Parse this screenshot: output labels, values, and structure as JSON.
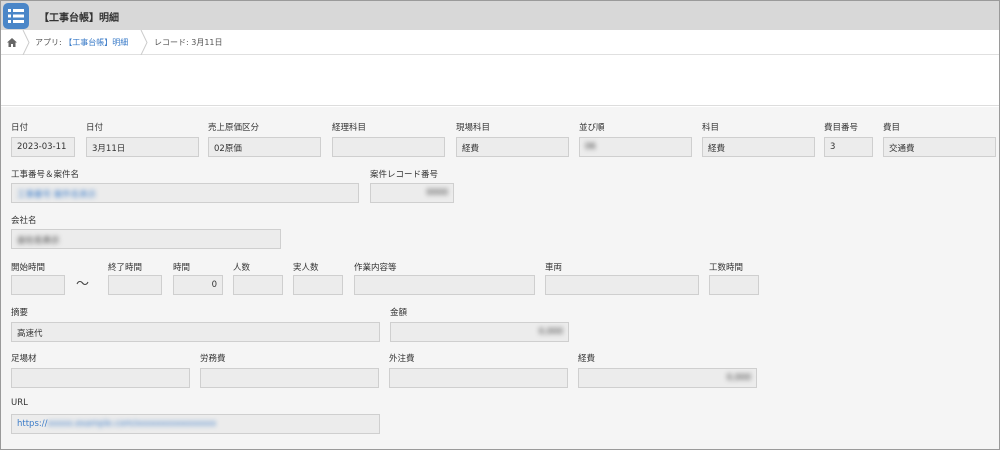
{
  "header": {
    "title": "【工事台帳】明細"
  },
  "breadcrumb": {
    "app_prefix": "アプリ: ",
    "app_name": "【工事台帳】明細",
    "record": "レコード: 3月11日"
  },
  "fields": {
    "date1": {
      "label": "日付",
      "value": "2023-03-11"
    },
    "date2": {
      "label": "日付",
      "value": "3月11日"
    },
    "sales_cost": {
      "label": "売上原価区分",
      "value": "02原価"
    },
    "account_item": {
      "label": "経理科目",
      "value": ""
    },
    "site_item": {
      "label": "現場科目",
      "value": "経費"
    },
    "order": {
      "label": "並び順",
      "value": "06"
    },
    "subject": {
      "label": "科目",
      "value": "経費"
    },
    "expense_no": {
      "label": "費目番号",
      "value": "3"
    },
    "expense": {
      "label": "費目",
      "value": "交通費"
    },
    "project": {
      "label": "工事番号＆案件名",
      "value": "工事番号 案件名表示"
    },
    "record_no": {
      "label": "案件レコード番号",
      "value": "0000"
    },
    "company": {
      "label": "会社名",
      "value": "会社名表示"
    },
    "start_time": {
      "label": "開始時間",
      "value": ""
    },
    "tilde": "〜",
    "end_time": {
      "label": "終了時間",
      "value": ""
    },
    "hours": {
      "label": "時間",
      "value": "0"
    },
    "people": {
      "label": "人数",
      "value": ""
    },
    "actual_people": {
      "label": "実人数",
      "value": ""
    },
    "work": {
      "label": "作業内容等",
      "value": ""
    },
    "vehicle": {
      "label": "車両",
      "value": ""
    },
    "man_hours": {
      "label": "工数時間",
      "value": ""
    },
    "summary": {
      "label": "摘要",
      "value": "高速代"
    },
    "amount": {
      "label": "金額",
      "value": "0,000"
    },
    "scaffold": {
      "label": "足場材",
      "value": ""
    },
    "labor": {
      "label": "労務費",
      "value": ""
    },
    "outsourcing": {
      "label": "外注費",
      "value": ""
    },
    "expenses": {
      "label": "経費",
      "value": "0,000"
    },
    "url": {
      "label": "URL",
      "value": "https://",
      "hidden_part": "xxxxx.example.com/xxxxxxxxxxxxxxxx"
    }
  },
  "colors": {
    "header_bg": "#d8d8d8",
    "app_icon": "#4a86c8",
    "link": "#3a7bc8"
  }
}
